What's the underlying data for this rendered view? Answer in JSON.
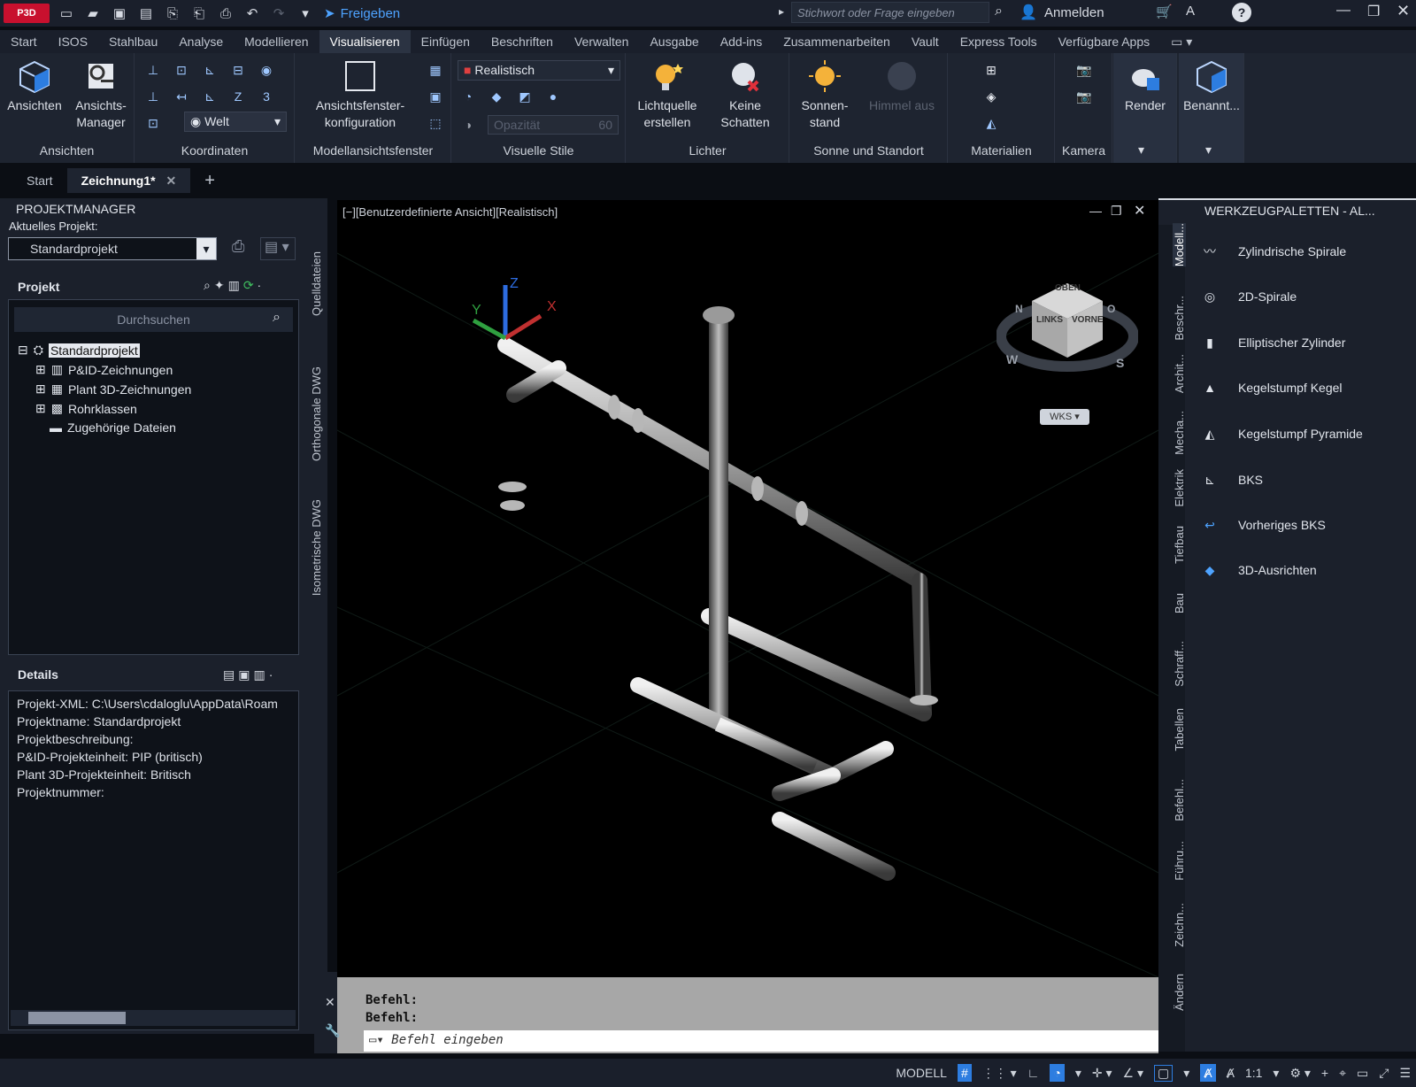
{
  "app": {
    "logo": "P3D",
    "share": "Freigeben",
    "search_placeholder": "Stichwort oder Frage eingeben",
    "signin": "Anmelden"
  },
  "menu_tabs": [
    "Start",
    "ISOS",
    "Stahlbau",
    "Analyse",
    "Modellieren",
    "Visualisieren",
    "Einfügen",
    "Beschriften",
    "Verwalten",
    "Ausgabe",
    "Add-ins",
    "Zusammenarbeiten",
    "Vault",
    "Express Tools",
    "Verfügbare Apps"
  ],
  "ribbon": {
    "ansichten": {
      "btn1": "Ansichten",
      "btn2a": "Ansichts-",
      "btn2b": "Manager",
      "label": "Ansichten"
    },
    "koordinaten": {
      "world": "Welt",
      "label": "Koordinaten"
    },
    "modellansicht": {
      "btn_a": "Ansichtsfenster-",
      "btn_b": "konfiguration",
      "label": "Modellansichtsfenster"
    },
    "stile": {
      "style": "Realistisch",
      "opacity": "Opazität",
      "opacity_val": "60",
      "label": "Visuelle Stile"
    },
    "lichter": {
      "b1a": "Lichtquelle",
      "b1b": "erstellen",
      "b2a": "Keine",
      "b2b": "Schatten",
      "label": "Lichter"
    },
    "sonne": {
      "b1a": "Sonnen-",
      "b1b": "stand",
      "b2": "Himmel aus",
      "label": "Sonne und Standort"
    },
    "materialien": {
      "label": "Materialien"
    },
    "kamera": {
      "label": "Kamera"
    },
    "render": {
      "label": "Render"
    },
    "benannt": {
      "label": "Benannt..."
    }
  },
  "doc_tabs": {
    "start": "Start",
    "drawing": "Zeichnung1*"
  },
  "project_manager": {
    "title": "PROJEKTMANAGER",
    "current_label": "Aktuelles Projekt:",
    "current_value": "Standardprojekt",
    "project_header": "Projekt",
    "search_placeholder": "Durchsuchen",
    "tree": [
      "Standardprojekt",
      "P&ID-Zeichnungen",
      "Plant 3D-Zeichnungen",
      "Rohrklassen",
      "Zugehörige Dateien"
    ],
    "details_header": "Details",
    "details": [
      "Projekt-XML:  C:\\Users\\cdaloglu\\AppData\\Roam",
      "Projektname:  Standardprojekt",
      "Projektbeschreibung:",
      "P&ID-Projekteinheit:  PIP  (britisch)",
      "Plant 3D-Projekteinheit:  Britisch",
      "Projektnummer:"
    ],
    "side_tabs": [
      "Quelldateien",
      "Orthogonale DWG",
      "Isometrische DWG"
    ]
  },
  "viewport": {
    "label": "[−][Benutzerdefinierte Ansicht][Realistisch]",
    "wcs": "WKS",
    "cube": {
      "top": "OBEN",
      "left": "LINKS",
      "front": "VORNE"
    },
    "compass": {
      "n": "N",
      "w": "W",
      "s": "S",
      "o": "O"
    },
    "axes": {
      "x": "X",
      "y": "Y",
      "z": "Z"
    }
  },
  "command": {
    "line1": "Befehl:",
    "line2": "Befehl:",
    "placeholder": "Befehl eingeben"
  },
  "tool_palette": {
    "title": "WERKZEUGPALETTEN - AL...",
    "items": [
      "Zylindrische Spirale",
      "2D-Spirale",
      "Elliptischer Zylinder",
      "Kegelstumpf Kegel",
      "Kegelstumpf Pyramide",
      "BKS",
      "Vorheriges BKS",
      "3D-Ausrichten"
    ],
    "side_tabs": [
      "Modell...",
      "Beschr...",
      "Archit...",
      "Mecha...",
      "Elektrik",
      "Tiefbau",
      "Bau",
      "Schraff...",
      "Tabellen",
      "Befehl...",
      "Führu...",
      "Zeichn...",
      "Ändern"
    ]
  },
  "status": {
    "model": "MODELL",
    "scale": "1:1"
  },
  "colors": {
    "accent": "#2d7de0",
    "bg": "#0b0e14",
    "panel": "#1b202b"
  }
}
